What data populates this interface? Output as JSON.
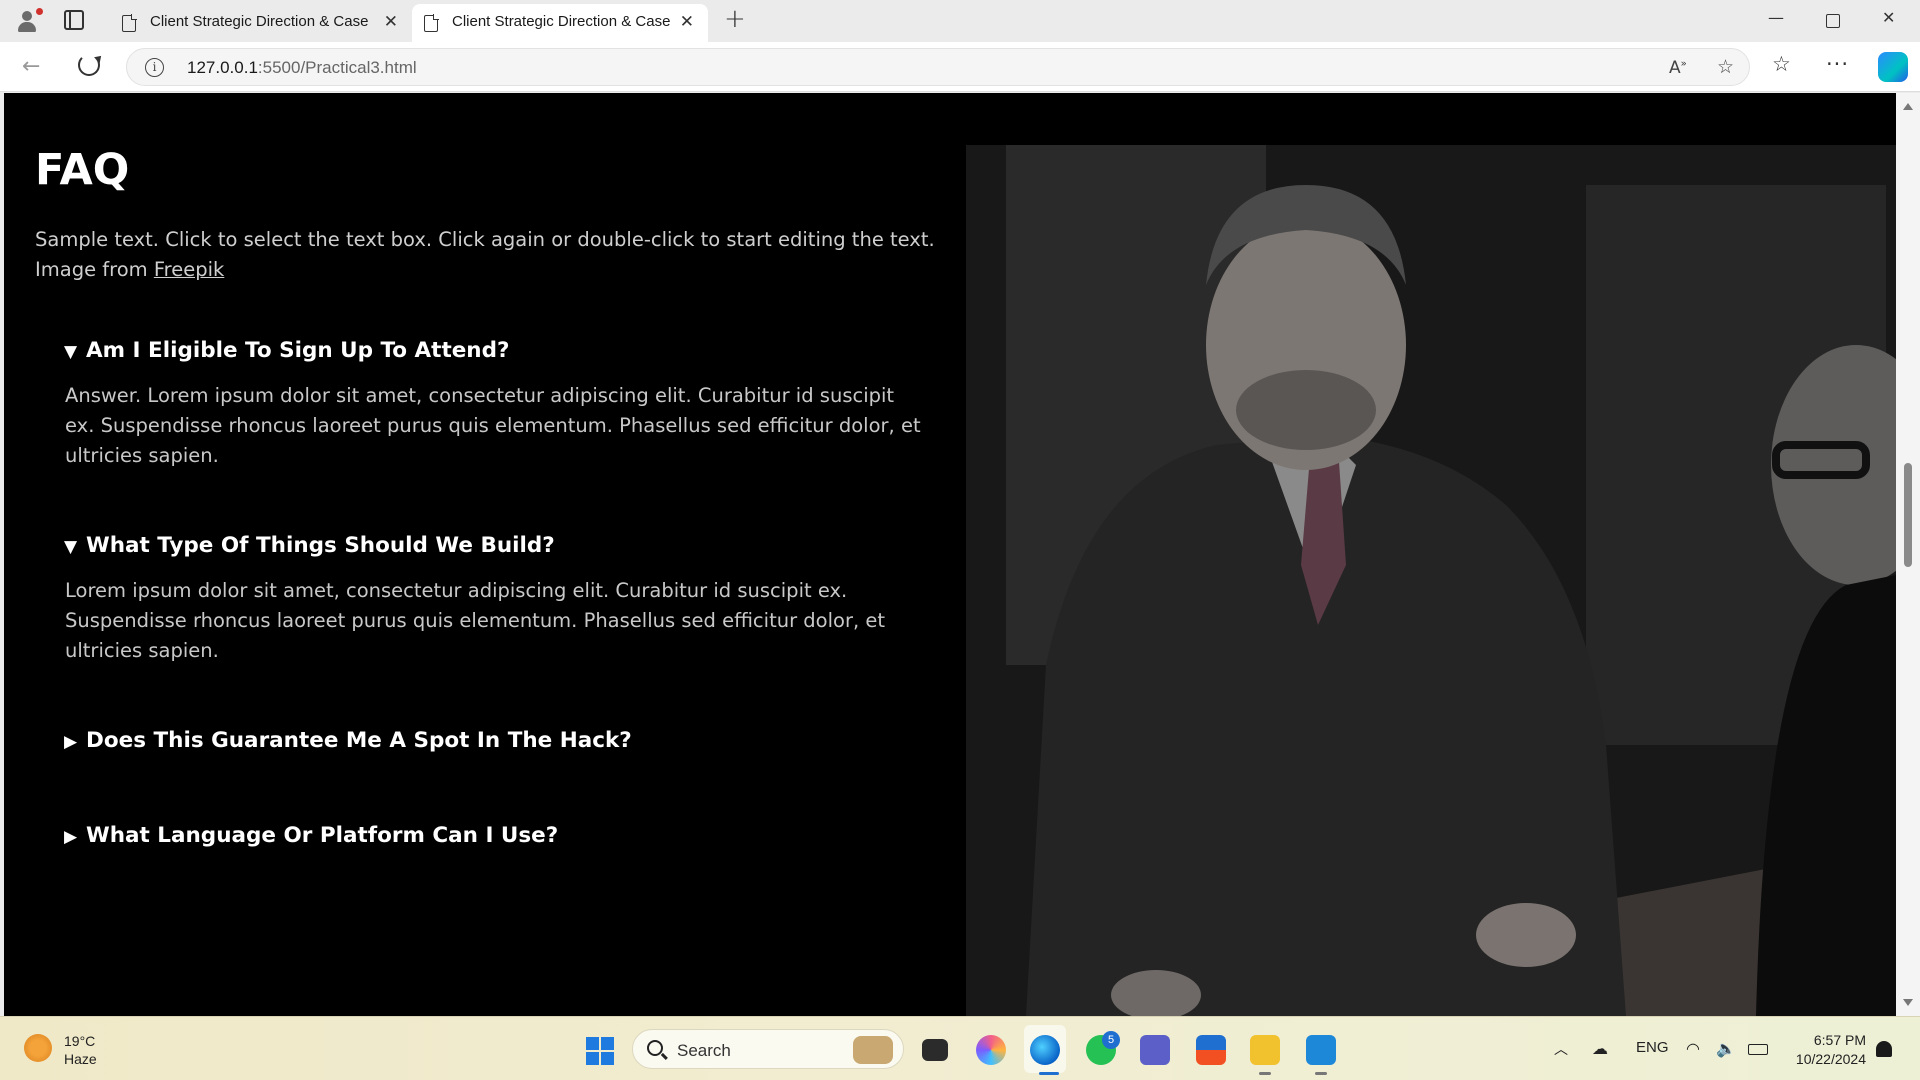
{
  "browser": {
    "tabs": [
      {
        "label": "Client Strategic Direction & Case Study"
      },
      {
        "label": "Client Strategic Direction & Case Study"
      }
    ],
    "url_host": "127.0.0.1",
    "url_rest": ":5500/Practical3.html"
  },
  "page": {
    "title": "FAQ",
    "intro_text": "Sample text. Click to select the text box. Click again or double-click to start editing the text. Image from",
    "intro_link": "Freepik",
    "faqs": [
      {
        "question": "Am I Eligible To Sign Up To Attend?",
        "open": true,
        "marker": "▼",
        "answer": "Answer. Lorem ipsum dolor sit amet, consectetur adipiscing elit. Curabitur id suscipit ex. Suspendisse rhoncus laoreet purus quis elementum. Phasellus sed efficitur dolor, et ultricies sapien."
      },
      {
        "question": "What Type Of Things Should We Build?",
        "open": true,
        "marker": "▼",
        "answer": "Lorem ipsum dolor sit amet, consectetur adipiscing elit. Curabitur id suscipit ex. Suspendisse rhoncus laoreet purus quis elementum. Phasellus sed efficitur dolor, et ultricies sapien."
      },
      {
        "question": "Does This Guarantee Me A Spot In The Hack?",
        "open": false,
        "marker": "▶"
      },
      {
        "question": "What Language Or Platform Can I Use?",
        "open": false,
        "marker": "▶"
      }
    ],
    "image_alt": "Businessman leaning over a table in a meeting"
  },
  "taskbar": {
    "weather_temp": "19°C",
    "weather_desc": "Haze",
    "search_placeholder": "Search",
    "whatsapp_badge": "5",
    "language": "ENG",
    "time": "6:57 PM",
    "date": "10/22/2024"
  }
}
